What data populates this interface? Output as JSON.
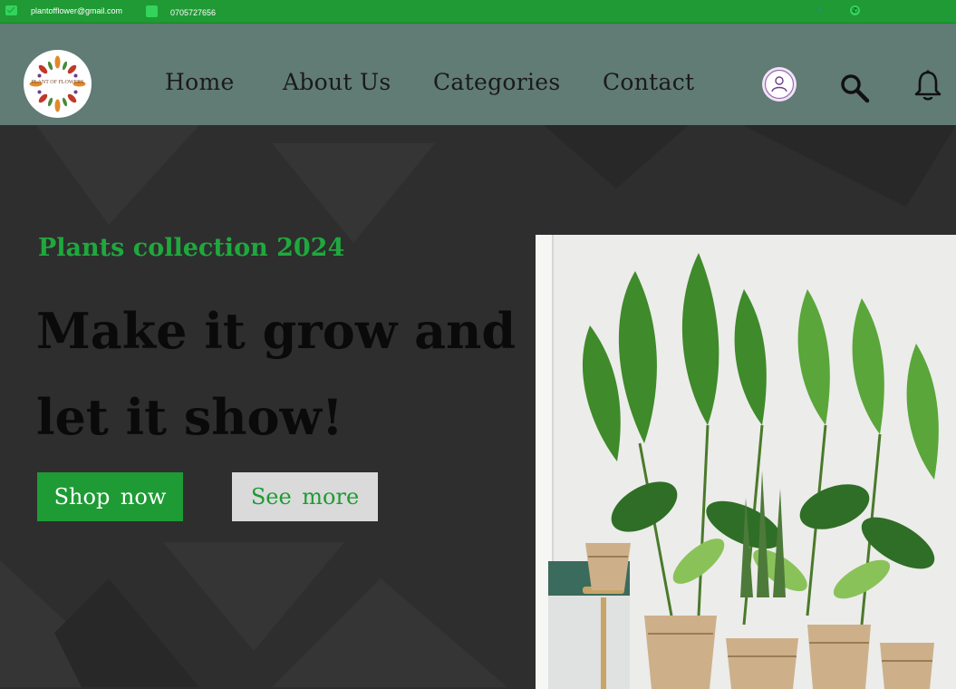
{
  "topbar": {
    "email": "plantofflower@gmail.com",
    "phone": "0705727656",
    "social": [
      "facebook-icon",
      "whatsapp-icon"
    ]
  },
  "logo": {
    "text": "PLANT OF FLOWERS"
  },
  "nav": {
    "items": [
      {
        "label": "Home"
      },
      {
        "label": "About Us"
      },
      {
        "label": "Categories"
      },
      {
        "label": "Contact"
      }
    ],
    "icons": [
      "user-icon",
      "search-icon",
      "bell-icon"
    ]
  },
  "hero": {
    "eyebrow": "Plants collection 2024",
    "headline": "Make it grow and let it show!",
    "buttons": {
      "primary": "Shop now",
      "secondary": "See more"
    }
  },
  "colors": {
    "brand_green": "#1e9b34",
    "nav_bg": "#617b75",
    "hero_bg": "#2e2e2e",
    "secondary_button": "#dadada"
  }
}
